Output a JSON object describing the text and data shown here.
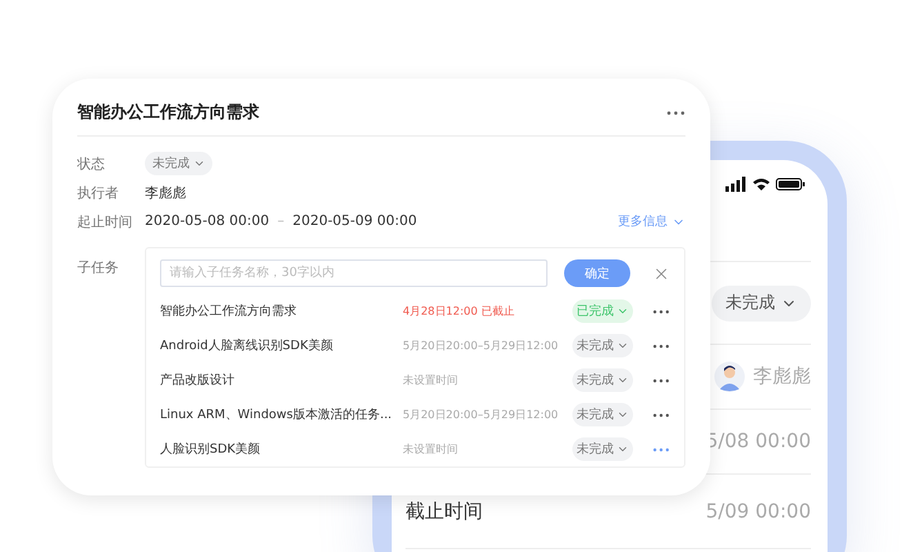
{
  "phone": {
    "status": "未完成",
    "assignee": "李彪彪",
    "start": "5/08 00:00",
    "end_label": "截止时间",
    "end": "5/09 00:00"
  },
  "card": {
    "title": "智能办公工作流方向需求",
    "fields": [
      {
        "kind": "status",
        "label": "状态",
        "value": "未完成"
      },
      {
        "kind": "text",
        "label": "执行者",
        "value": "李彪彪"
      },
      {
        "kind": "range",
        "label": "起止时间",
        "start": "2020-05-08 00:00",
        "separator": "–",
        "end": "2020-05-09 00:00"
      }
    ],
    "more_link": "更多信息",
    "subtasks": {
      "label": "子任务",
      "placeholder": "请输入子任务名称，30字以内",
      "confirm": "确定",
      "rows": [
        {
          "name": "智能办公工作流方向需求",
          "time": "4月28日12:00 已截止",
          "overdue": true,
          "status": "已完成",
          "done": true,
          "highlighted": false
        },
        {
          "name": "Android人脸离线识别SDK美颜",
          "time": "5月20日20:00–5月29日12:00",
          "overdue": false,
          "status": "未完成",
          "done": false,
          "highlighted": false
        },
        {
          "name": "产品改版设计",
          "time": "未设置时间",
          "overdue": false,
          "status": "未完成",
          "done": false,
          "highlighted": false
        },
        {
          "name": "Linux ARM、Windows版本激活的任务...",
          "time": "5月20日20:00–5月29日12:00",
          "overdue": false,
          "status": "未完成",
          "done": false,
          "highlighted": false
        },
        {
          "name": "人脸识别SDK美颜",
          "time": "未设置时间",
          "overdue": false,
          "status": "未完成",
          "done": false,
          "highlighted": true
        }
      ]
    }
  }
}
